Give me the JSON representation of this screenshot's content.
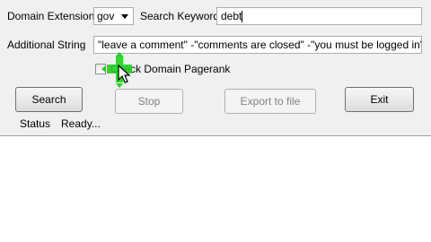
{
  "form": {
    "domain_extension_label": "Domain Extension",
    "domain_extension_value": "gov",
    "search_keyword_label": "Search Keyword",
    "search_keyword_value": "debt",
    "additional_string_label": "Additional String",
    "additional_string_value": "\"leave a comment\" -\"comments are closed\" -\"you must be logged in\"",
    "pagerank_checkbox_label": "Check Domain Pagerank",
    "pagerank_checked": false
  },
  "buttons": {
    "search": "Search",
    "stop": "Stop",
    "export": "Export to file",
    "exit": "Exit"
  },
  "status": {
    "label": "Status",
    "value": "Ready..."
  },
  "colors": {
    "highlight_cursor": "#1ed21e",
    "window_bg": "#f0f0f0"
  }
}
